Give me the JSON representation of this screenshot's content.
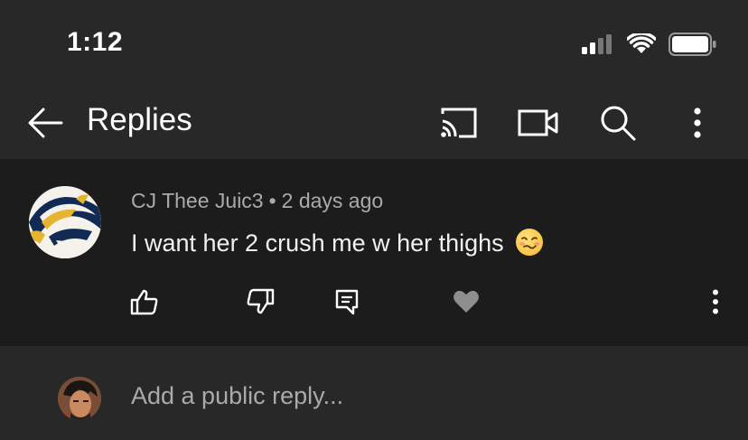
{
  "status": {
    "time": "1:12"
  },
  "header": {
    "title": "Replies"
  },
  "comment": {
    "author": "CJ Thee Juic3",
    "separator": "•",
    "age": "2 days ago",
    "text": "I want her 2 crush me w her thighs"
  },
  "reply": {
    "placeholder": "Add a public reply..."
  },
  "colors": {
    "background": "#282828",
    "comment_bg": "#1c1c1c",
    "muted_text": "#aaaaaa"
  },
  "icons": [
    "back-arrow-icon",
    "cast-icon",
    "camera-icon",
    "search-icon",
    "more-vert-icon",
    "thumbs-up-icon",
    "thumbs-down-icon",
    "comment-icon",
    "heart-icon"
  ]
}
